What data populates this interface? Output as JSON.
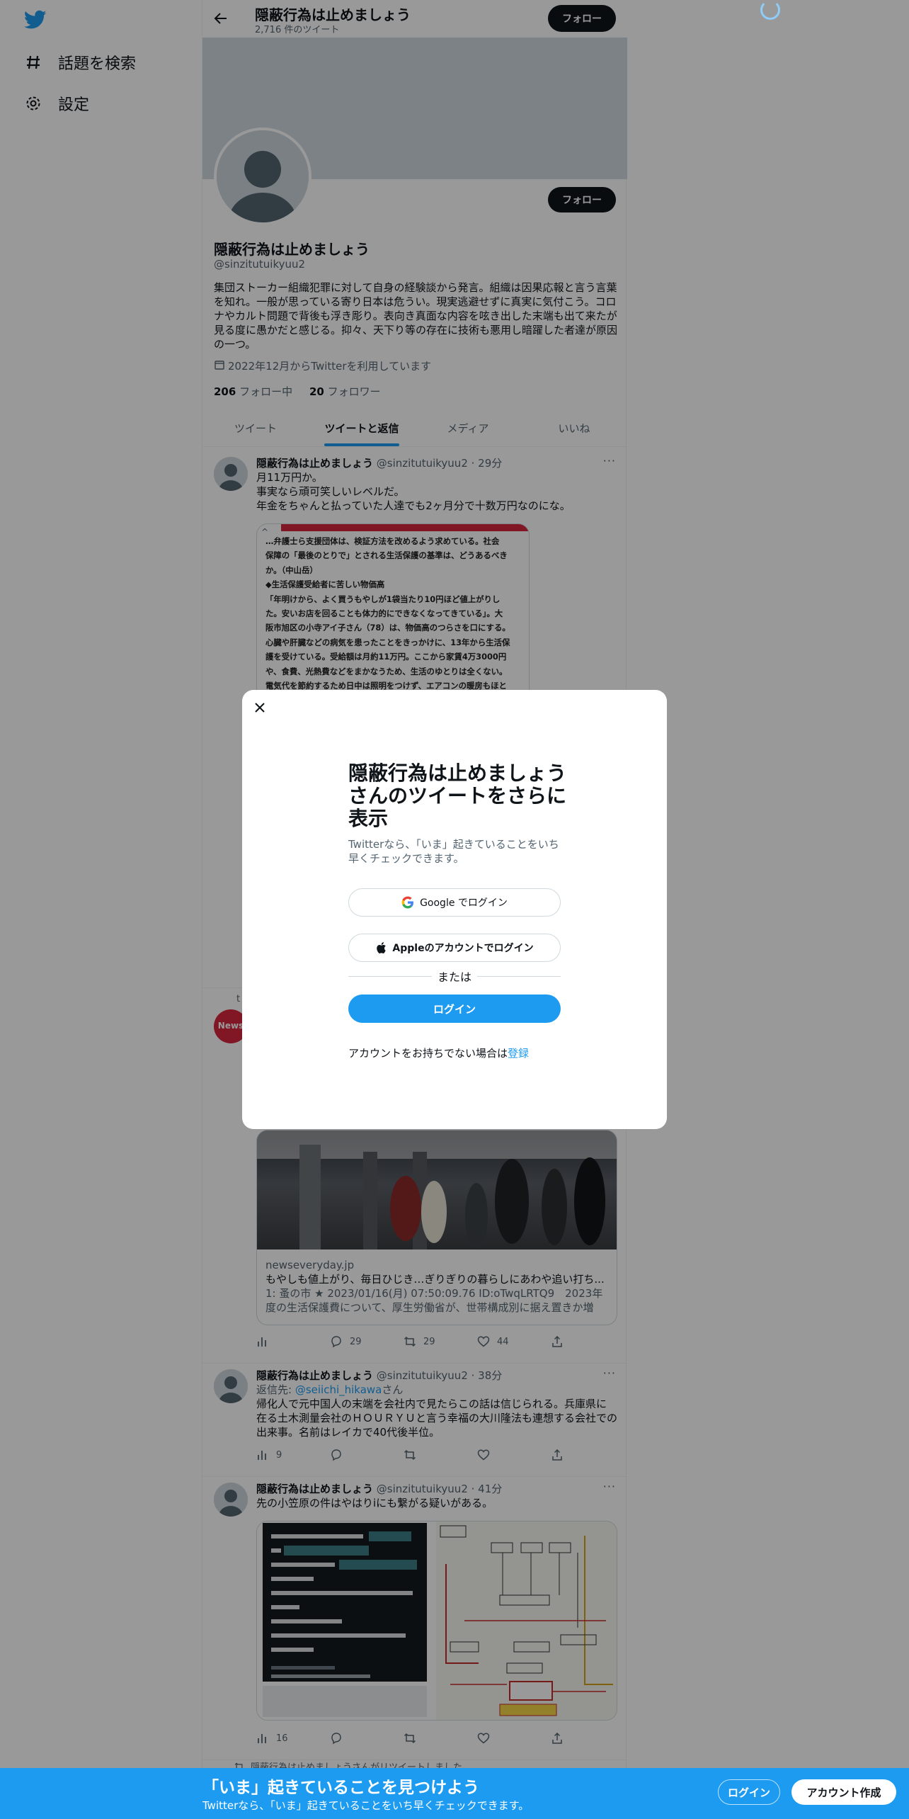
{
  "nav": {
    "explore_label": "話題を検索",
    "settings_label": "設定"
  },
  "header": {
    "title": "隠蔽行為は止めましょう",
    "tweet_count": "2,716 件のツイート",
    "follow_label": "フォロー"
  },
  "profile": {
    "name": "隠蔽行為は止めましょう",
    "handle": "@sinzitutuikyuu2",
    "bio": "集団ストーカー組織犯罪に対して自身の経験談から発言。組織は因果応報と言う言葉を知れ。一般が思っている寄り日本は危うい。現実逃避せずに真実に気付こう。コロナやカルト問題で背後も浮き彫り。表向き真面な内容を呟き出した末端も出て来たが見る度に愚かだと感じる。抑々、天下り等の存在に技術も悪用し暗躍した者達が原因の一つ。",
    "joined": "2022年12月からTwitterを利用しています",
    "following_count": "206",
    "following_label": "フォロー中",
    "followers_count": "20",
    "followers_label": "フォロワー",
    "follow_label": "フォロー"
  },
  "tabs": [
    "ツイート",
    "ツイートと返信",
    "メディア",
    "いいね"
  ],
  "tweets": [
    {
      "name": "隠蔽行為は止めましょう",
      "meta": "@sinzitutuikyuu2 · 29分",
      "lines": [
        "月11万円か。",
        "事実なら頑可笑しいレベルだ。",
        "年金をちゃんと払っていた人達でも2ヶ月分で十数万円なのにな。"
      ],
      "article_lines": [
        "…弁護士ら支援団体は、検証方法を改めるよう求めている。社会",
        "保障の「最後のとりで」とされる生活保護の基準は、どうあるべき",
        "か。（中山岳）",
        "◆生活保護受給者に苦しい物価高",
        "「年明けから、よく買うもやしが1袋当たり10円ほど値上がりし",
        "た。安いお店を回ることも体力的にできなくなってきている」。大",
        "阪市旭区の小寺アイ子さん（78）は、物価高のつらさを口にする。",
        "心臓や肝臓などの病気を患ったことをきっかけに、13年から生活保",
        "護を受けている。受給額は月約11万円。ここから家賃4万3000円",
        "や、食費、光熱費などをまかなうため、生活のゆとりは全くない。",
        "電気代を節約するため日中は照明をつけず、エアコンの暖房もほと"
      ]
    },
    {
      "card_domain": "newseveryday.jp",
      "card_title": "もやしも値上がり、毎日ひじき…ぎりぎりの暮らしにあわや追い打ち...",
      "card_desc": "1: 蚤の市 ★ 2023/01/16(月) 07:50:09.76 ID:oTwqLRTQ9　2023年度の生活保護費について、厚生労働省が、世帯構成別に据え置きか増額...",
      "views": "",
      "replies": "29",
      "retweets": "29",
      "likes": "44"
    },
    {
      "name": "隠蔽行為は止めましょう",
      "meta": "@sinzitutuikyuu2 · 38分",
      "reply_prefix": "返信先: ",
      "reply_to": "@seiichi_hikawa",
      "reply_suffix": "さん",
      "lines": [
        "帰化人で元中国人の末端を会社内で見たら",
        "この話は信じられる。兵庫県に在る土木測量会社のＨＯＵＲＹＵと言う幸福の大川隆法も連想する会社での出来事。名前はレイカで40代後半位。"
      ],
      "views": "9"
    },
    {
      "name": "隠蔽行為は止めましょう",
      "meta": "@sinzitutuikyuu2 · 41分",
      "lines": [
        "先の小笠原の件はやはりiにも繋がる疑いがある。"
      ],
      "views": "16"
    }
  ],
  "retweet_label": "隠蔽行為は止めましょうさんがリツイートしました",
  "modal": {
    "title": "隠蔽行為は止めましょうさんのツイートをさらに表示",
    "subtitle": "Twitterなら、「いま」起きていることをいち早くチェックできます。",
    "google_label": "Google でログイン",
    "apple_label": "Appleのアカウントでログイン",
    "or_label": "または",
    "login_label": "ログイン",
    "signup_prefix": "アカウントをお持ちでない場合は",
    "signup_link": "登録"
  },
  "bottom_bar": {
    "title": "「いま」起きていることを見つけよう",
    "subtitle": "Twitterなら、「いま」起きていることをいち早くチェックできます。",
    "login_label": "ログイン",
    "signup_label": "アカウント作成"
  },
  "colors": {
    "accent": "#1d9bf0",
    "dark_button": "#0f1419",
    "overlay": "rgba(0,0,0,0.4)"
  }
}
